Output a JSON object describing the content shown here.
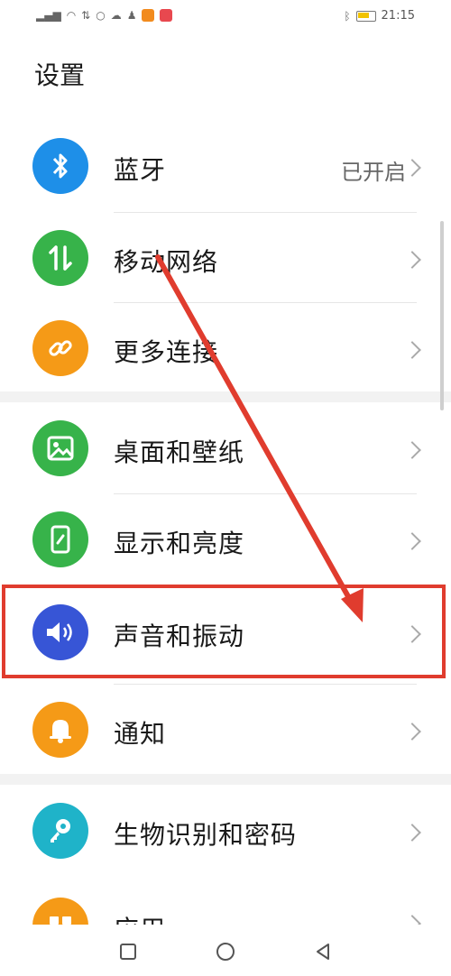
{
  "status": {
    "time": "21:15"
  },
  "header": {
    "title": "设置"
  },
  "items": [
    {
      "label": "蓝牙",
      "value": "已开启",
      "icon": "bluetooth-icon",
      "color": "#1e8fe8"
    },
    {
      "label": "移动网络",
      "value": "",
      "icon": "mobile-data-icon",
      "color": "#37b34a"
    },
    {
      "label": "更多连接",
      "value": "",
      "icon": "link-icon",
      "color": "#f59a17"
    },
    {
      "label": "桌面和壁纸",
      "value": "",
      "icon": "wallpaper-icon",
      "color": "#37b34a"
    },
    {
      "label": "显示和亮度",
      "value": "",
      "icon": "display-icon",
      "color": "#37b34a"
    },
    {
      "label": "声音和振动",
      "value": "",
      "icon": "sound-icon",
      "color": "#3755d6"
    },
    {
      "label": "通知",
      "value": "",
      "icon": "bell-icon",
      "color": "#f59a17"
    },
    {
      "label": "生物识别和密码",
      "value": "",
      "icon": "key-icon",
      "color": "#1fb3c9"
    },
    {
      "label": "应用",
      "value": "",
      "icon": "apps-icon",
      "color": "#f59a17"
    }
  ],
  "annotation": {
    "highlight_color": "#e03c2e"
  },
  "nav": {
    "icons": [
      "square-icon",
      "circle-icon",
      "back-triangle-icon"
    ]
  }
}
